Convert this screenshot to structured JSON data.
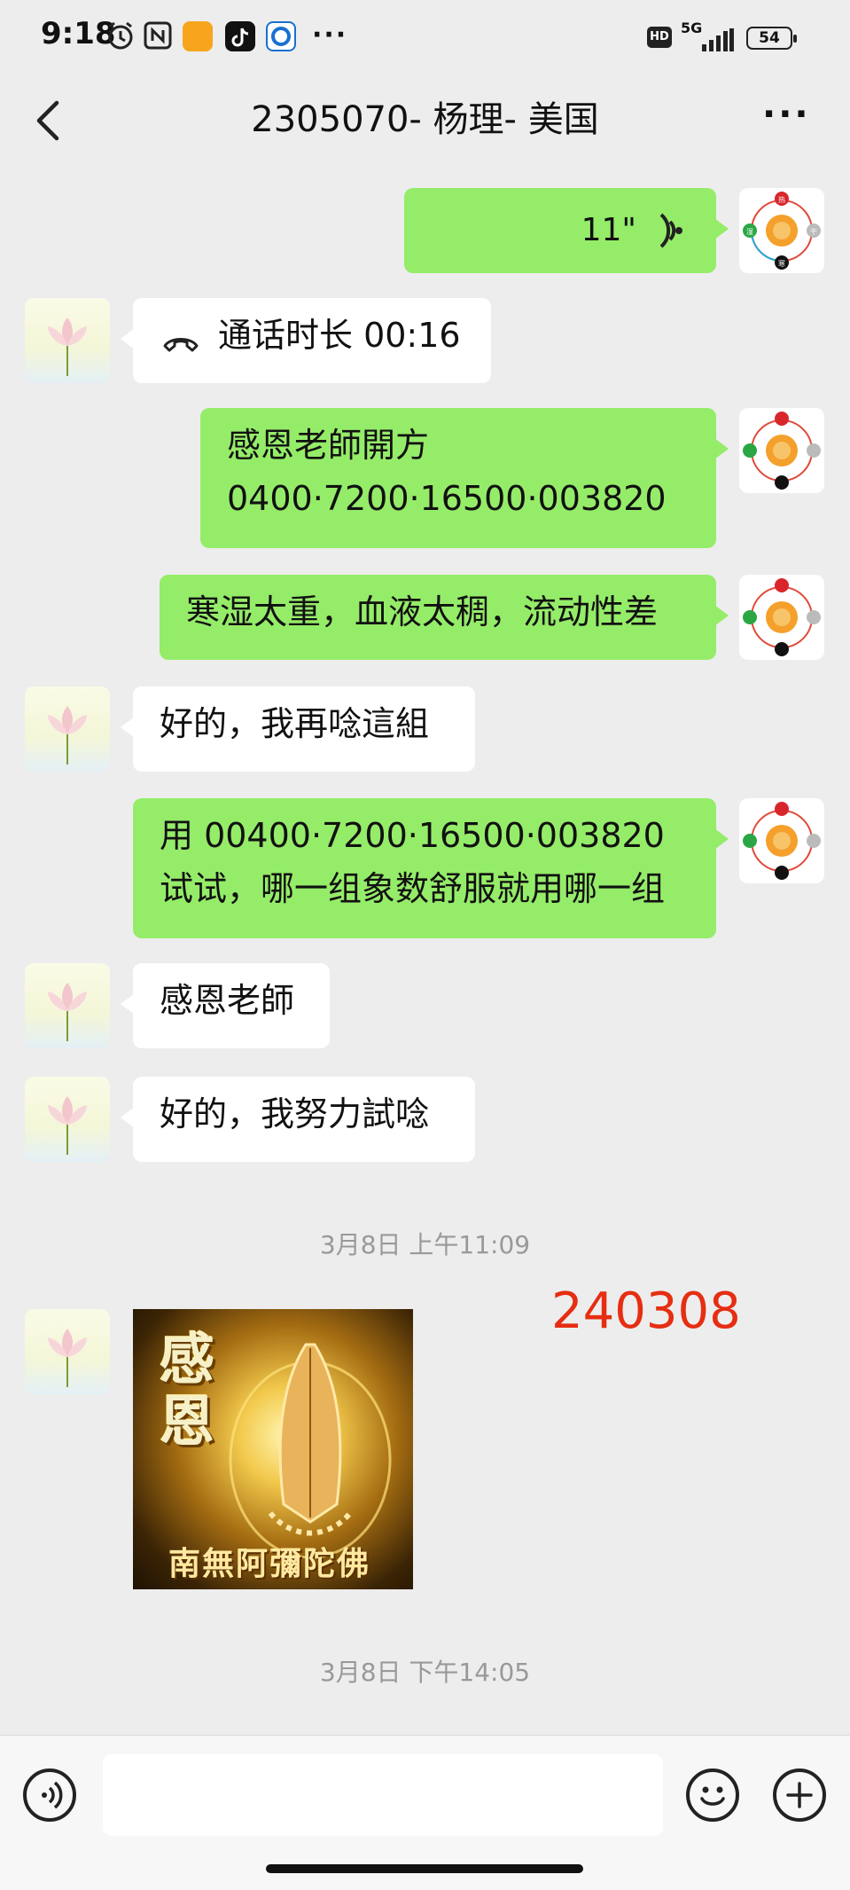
{
  "status_bar": {
    "time": "9:18",
    "dots": "···",
    "hd": "HD",
    "network": "5G",
    "battery": "54"
  },
  "nav": {
    "title": "2305070- 杨理- 美国",
    "more": "···"
  },
  "messages": [
    {
      "side": "right",
      "type": "voice",
      "duration": "11\""
    },
    {
      "side": "left",
      "type": "call",
      "text": "通话时长 00:16"
    },
    {
      "side": "right",
      "type": "text",
      "lines": [
        "感恩老師開方",
        "0400·7200·16500·003820"
      ]
    },
    {
      "side": "right",
      "type": "text",
      "lines": [
        "寒湿太重，血液太稠，流动性差"
      ]
    },
    {
      "side": "left",
      "type": "text",
      "lines": [
        "好的，我再唸這組"
      ]
    },
    {
      "side": "right",
      "type": "text",
      "lines": [
        "用 00400·7200·16500·003820",
        "试试，哪一组象数舒服就用哪一组"
      ]
    },
    {
      "side": "left",
      "type": "text",
      "lines": [
        "感恩老師"
      ]
    },
    {
      "side": "left",
      "type": "text",
      "lines": [
        "好的，我努力試唸"
      ]
    }
  ],
  "timestamps": [
    "3月8日 上午11:09",
    "3月8日 下午14:05"
  ],
  "marker_text": "240308",
  "sticker": {
    "line1": "感",
    "line2": "恩",
    "caption": "南無阿彌陀佛"
  },
  "tcm_avatar_labels": [
    "热",
    "湿",
    "寒",
    "干"
  ],
  "colors": {
    "my_bubble": "#95ec69",
    "their_bubble": "#ffffff",
    "background": "#ededed",
    "marker": "#e62e12"
  },
  "icons": {
    "voice_toggle": "voice-icon",
    "emoji": "emoji-icon",
    "add": "plus-icon"
  }
}
